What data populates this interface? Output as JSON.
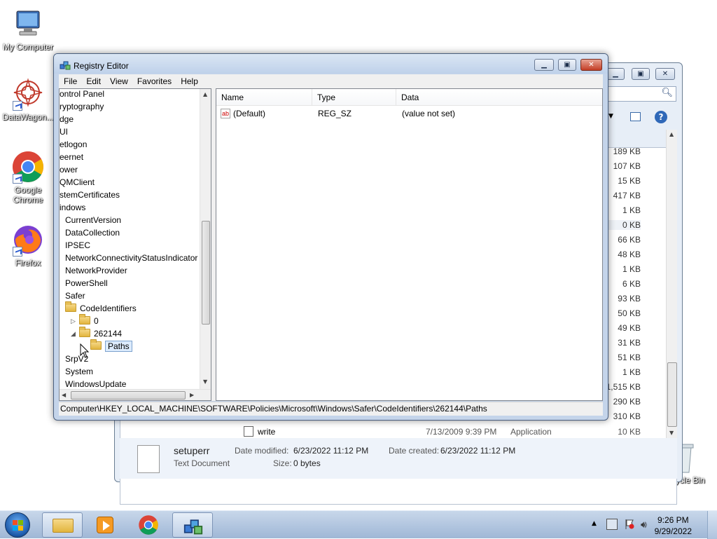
{
  "desktop": {
    "icons": [
      {
        "label": "My Computer"
      },
      {
        "label": "DataWagon..."
      },
      {
        "label": "Google Chrome"
      },
      {
        "label": "Firefox"
      },
      {
        "label": "Recycle Bin"
      }
    ]
  },
  "explorer": {
    "sizes": [
      "189 KB",
      "107 KB",
      "15 KB",
      "417 KB",
      "1 KB",
      "0 KB",
      "66 KB",
      "48 KB",
      "1 KB",
      "6 KB",
      "93 KB",
      "50 KB",
      "49 KB",
      "31 KB",
      "51 KB",
      "1 KB",
      "1,515 KB",
      "290 KB",
      "310 KB"
    ],
    "last_row": {
      "name": "write",
      "date": "7/13/2009 9:39 PM",
      "type": "Application",
      "size": "10 KB"
    },
    "details": {
      "file_name": "setuperr",
      "file_type": "Text Document",
      "date_modified_label": "Date modified:",
      "date_modified": "6/23/2022 11:12 PM",
      "date_created_label": "Date created:",
      "date_created": "6/23/2022 11:12 PM",
      "size_label": "Size:",
      "size": "0 bytes"
    }
  },
  "regedit": {
    "title": "Registry Editor",
    "menu": [
      "File",
      "Edit",
      "View",
      "Favorites",
      "Help"
    ],
    "tree": [
      "ontrol Panel",
      "ryptography",
      "dge",
      "UI",
      "etlogon",
      "eernet",
      "ower",
      "QMClient",
      "stemCertificates",
      "indows",
      "CurrentVersion",
      "DataCollection",
      "IPSEC",
      "NetworkConnectivityStatusIndicator",
      "NetworkProvider",
      "PowerShell",
      "Safer",
      "CodeIdentifiers",
      "0",
      "262144",
      "Paths",
      "SrpV2",
      "System",
      "WindowsUpdate"
    ],
    "columns": {
      "name": "Name",
      "type": "Type",
      "data": "Data"
    },
    "values": [
      {
        "name": "(Default)",
        "type": "REG_SZ",
        "data": "(value not set)",
        "icon": "ab"
      }
    ],
    "status_path": "Computer\\HKEY_LOCAL_MACHINE\\SOFTWARE\\Policies\\Microsoft\\Windows\\Safer\\CodeIdentifiers\\262144\\Paths"
  },
  "taskbar": {
    "time": "9:26 PM",
    "date": "9/29/2022"
  }
}
